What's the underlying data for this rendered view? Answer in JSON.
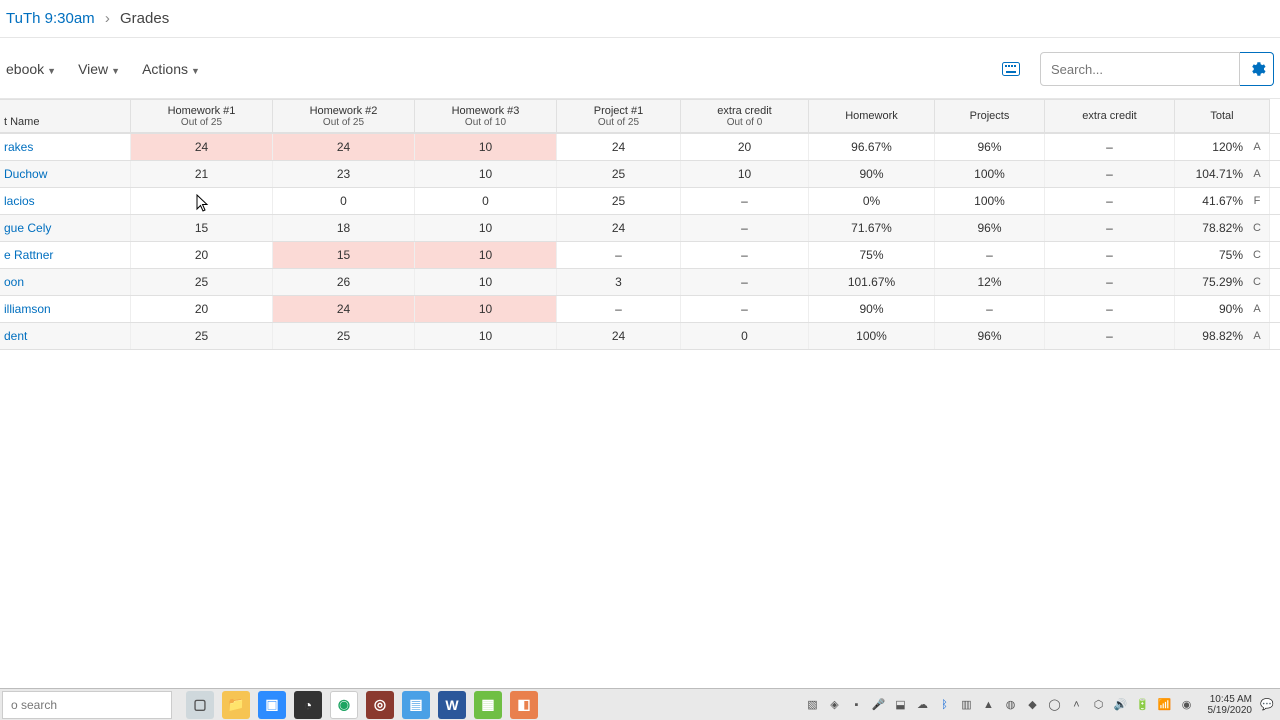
{
  "breadcrumb": {
    "course": "TuTh 9:30am",
    "page": "Grades"
  },
  "toolbar": {
    "gradebook": "ebook",
    "view": "View",
    "actions": "Actions",
    "search_placeholder": "Search..."
  },
  "columns": {
    "name": {
      "title": "t Name",
      "sub": ""
    },
    "hw1": {
      "title": "Homework #1",
      "sub": "Out of 25"
    },
    "hw2": {
      "title": "Homework #2",
      "sub": "Out of 25"
    },
    "hw3": {
      "title": "Homework #3",
      "sub": "Out of 10"
    },
    "proj1": {
      "title": "Project #1",
      "sub": "Out of 25"
    },
    "ec": {
      "title": "extra credit",
      "sub": "Out of 0"
    },
    "hwcat": {
      "title": "Homework"
    },
    "projcat": {
      "title": "Projects"
    },
    "eccat": {
      "title": "extra credit"
    },
    "total": {
      "title": "Total"
    }
  },
  "rows": [
    {
      "name": "rakes",
      "hw1": {
        "v": "24",
        "c": "pink"
      },
      "hw2": {
        "v": "24",
        "c": "pink"
      },
      "hw3": {
        "v": "10",
        "c": "pink"
      },
      "proj1": "24",
      "ec": "20",
      "hwcat": "96.67%",
      "projcat": "96%",
      "eccat": "–",
      "total": "120%",
      "grade": "A"
    },
    {
      "name": "Duchow",
      "hw1": {
        "v": "21",
        "c": "pink"
      },
      "hw2": {
        "v": "23",
        "c": "pink"
      },
      "hw3": {
        "v": "10",
        "c": "pink"
      },
      "proj1": "25",
      "ec": "10",
      "hwcat": "90%",
      "projcat": "100%",
      "eccat": "–",
      "total": "104.71%",
      "grade": "A"
    },
    {
      "name": "lacios",
      "hw1": {
        "v": "–",
        "c": ""
      },
      "hw2": {
        "v": "0",
        "c": ""
      },
      "hw3": {
        "v": "0",
        "c": ""
      },
      "proj1": "25",
      "ec": "–",
      "hwcat": "0%",
      "projcat": "100%",
      "eccat": "–",
      "total": "41.67%",
      "grade": "F"
    },
    {
      "name": "gue Cely",
      "hw1": {
        "v": "15",
        "c": ""
      },
      "hw2": {
        "v": "18",
        "c": "pink"
      },
      "hw3": {
        "v": "10",
        "c": "pink"
      },
      "proj1": "24",
      "ec": "–",
      "hwcat": "71.67%",
      "projcat": "96%",
      "eccat": "–",
      "total": "78.82%",
      "grade": "C"
    },
    {
      "name": "e Rattner",
      "hw1": {
        "v": "20",
        "c": ""
      },
      "hw2": {
        "v": "15",
        "c": "pink"
      },
      "hw3": {
        "v": "10",
        "c": "pink"
      },
      "proj1": "–",
      "ec": "–",
      "hwcat": "75%",
      "projcat": "–",
      "eccat": "–",
      "total": "75%",
      "grade": "C"
    },
    {
      "name": "oon",
      "hw1": {
        "v": "25",
        "c": ""
      },
      "hw2": {
        "v": "26",
        "c": "pink"
      },
      "hw3": {
        "v": "10",
        "c": "blue"
      },
      "proj1": "3",
      "ec": "–",
      "hwcat": "101.67%",
      "projcat": "12%",
      "eccat": "–",
      "total": "75.29%",
      "grade": "C"
    },
    {
      "name": "illiamson",
      "hw1": {
        "v": "20",
        "c": ""
      },
      "hw2": {
        "v": "24",
        "c": "pink"
      },
      "hw3": {
        "v": "10",
        "c": "pink"
      },
      "proj1": "–",
      "ec": "–",
      "hwcat": "90%",
      "projcat": "–",
      "eccat": "–",
      "total": "90%",
      "grade": "A"
    },
    {
      "name": "dent",
      "hw1": {
        "v": "25",
        "c": ""
      },
      "hw2": {
        "v": "25",
        "c": ""
      },
      "hw3": {
        "v": "10",
        "c": "pink"
      },
      "proj1": "24",
      "ec": "0",
      "hwcat": "100%",
      "projcat": "96%",
      "eccat": "–",
      "total": "98.82%",
      "grade": "A"
    }
  ],
  "taskbar": {
    "search_placeholder": "o search",
    "time": "10:45 AM",
    "date": "5/19/2020"
  }
}
